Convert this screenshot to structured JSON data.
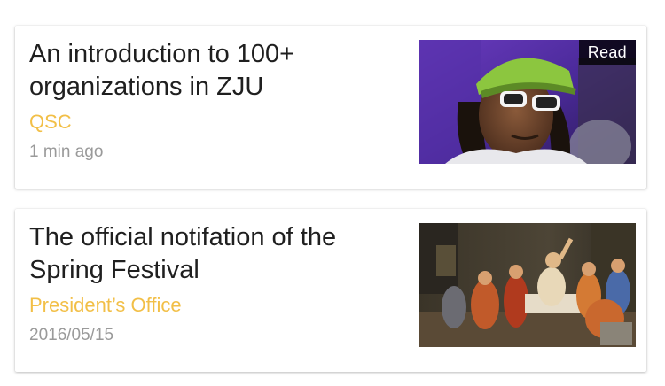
{
  "feed": {
    "articles": [
      {
        "title": "An introduction to 100+ organizations in ZJU",
        "source": "QSC",
        "time": "1 min ago",
        "badge": "Read",
        "thumbnail_icon": "photo-portrait-icon"
      },
      {
        "title": "The official notifation of the Spring Festival",
        "source": "President’s Office",
        "time": "2016/05/15",
        "thumbnail_icon": "photo-painting-icon"
      }
    ]
  },
  "colors": {
    "source_accent": "#f2bf47",
    "title": "#1f1f1f",
    "time": "#9a9a9a",
    "badge_bg": "#000000"
  }
}
